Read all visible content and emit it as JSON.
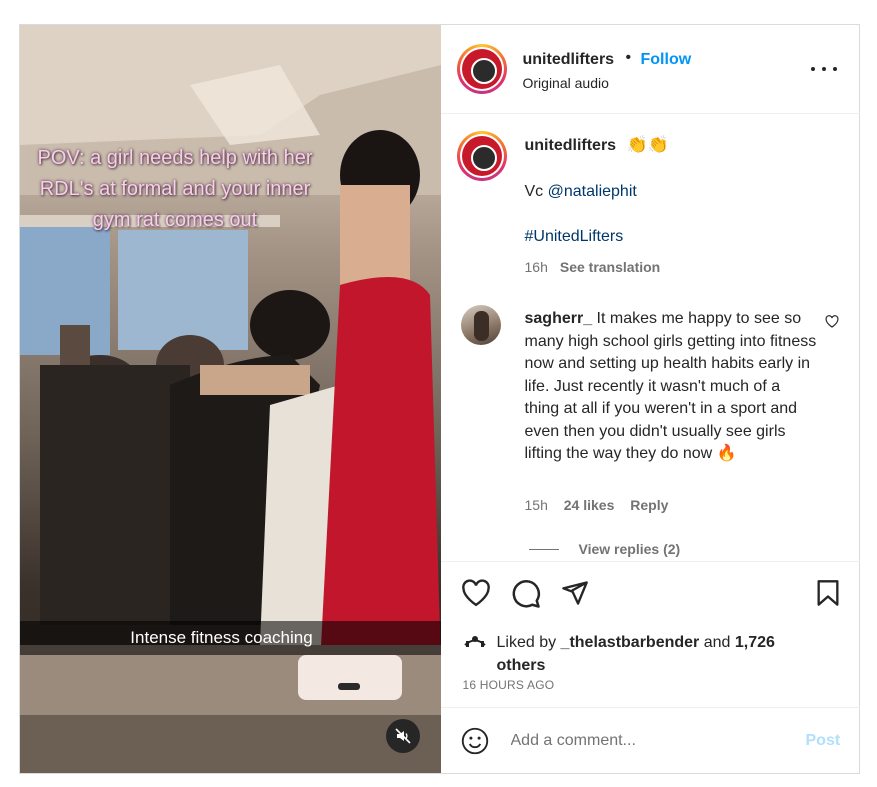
{
  "media": {
    "overlay_text": "POV: a girl needs help with her RDL's at formal and your inner gym rat comes out",
    "caption_text": "Intense fitness coaching",
    "mute_icon": "speaker-muted-icon"
  },
  "header": {
    "username": "unitedlifters",
    "separator": "•",
    "follow_label": "Follow",
    "audio_label": "Original audio"
  },
  "caption": {
    "username": "unitedlifters",
    "emoji": "👏👏",
    "line1_prefix": "Vc ",
    "mention": "@nataliephit",
    "hashtag": "#UnitedLifters",
    "time": "16h",
    "translate_label": "See translation"
  },
  "comment": {
    "username": "sagherr_",
    "text": "It makes me happy to see so many high school girls getting into fitness now and setting up health habits early in life. Just recently it wasn't much of a thing at all if you weren't in a sport and even then you didn't usually see girls lifting the way they do now 🔥",
    "time": "15h",
    "likes": "24 likes",
    "reply_label": "Reply",
    "view_replies": "View replies (2)"
  },
  "actions": {
    "icons": [
      "heart-icon",
      "comment-icon",
      "share-icon",
      "bookmark-icon"
    ],
    "liked_prefix": "Liked by ",
    "liked_user": "_thelastbarbender",
    "liked_and": " and ",
    "liked_count": "1,726",
    "liked_suffix": "others",
    "time_ago": "16 HOURS AGO"
  },
  "add_comment": {
    "placeholder": "Add a comment...",
    "post_label": "Post"
  },
  "colors": {
    "link_blue": "#0095f6",
    "mention_blue": "#00376b",
    "post_disabled": "#b2dffc",
    "overlay_pink": "#f7cfe8"
  }
}
